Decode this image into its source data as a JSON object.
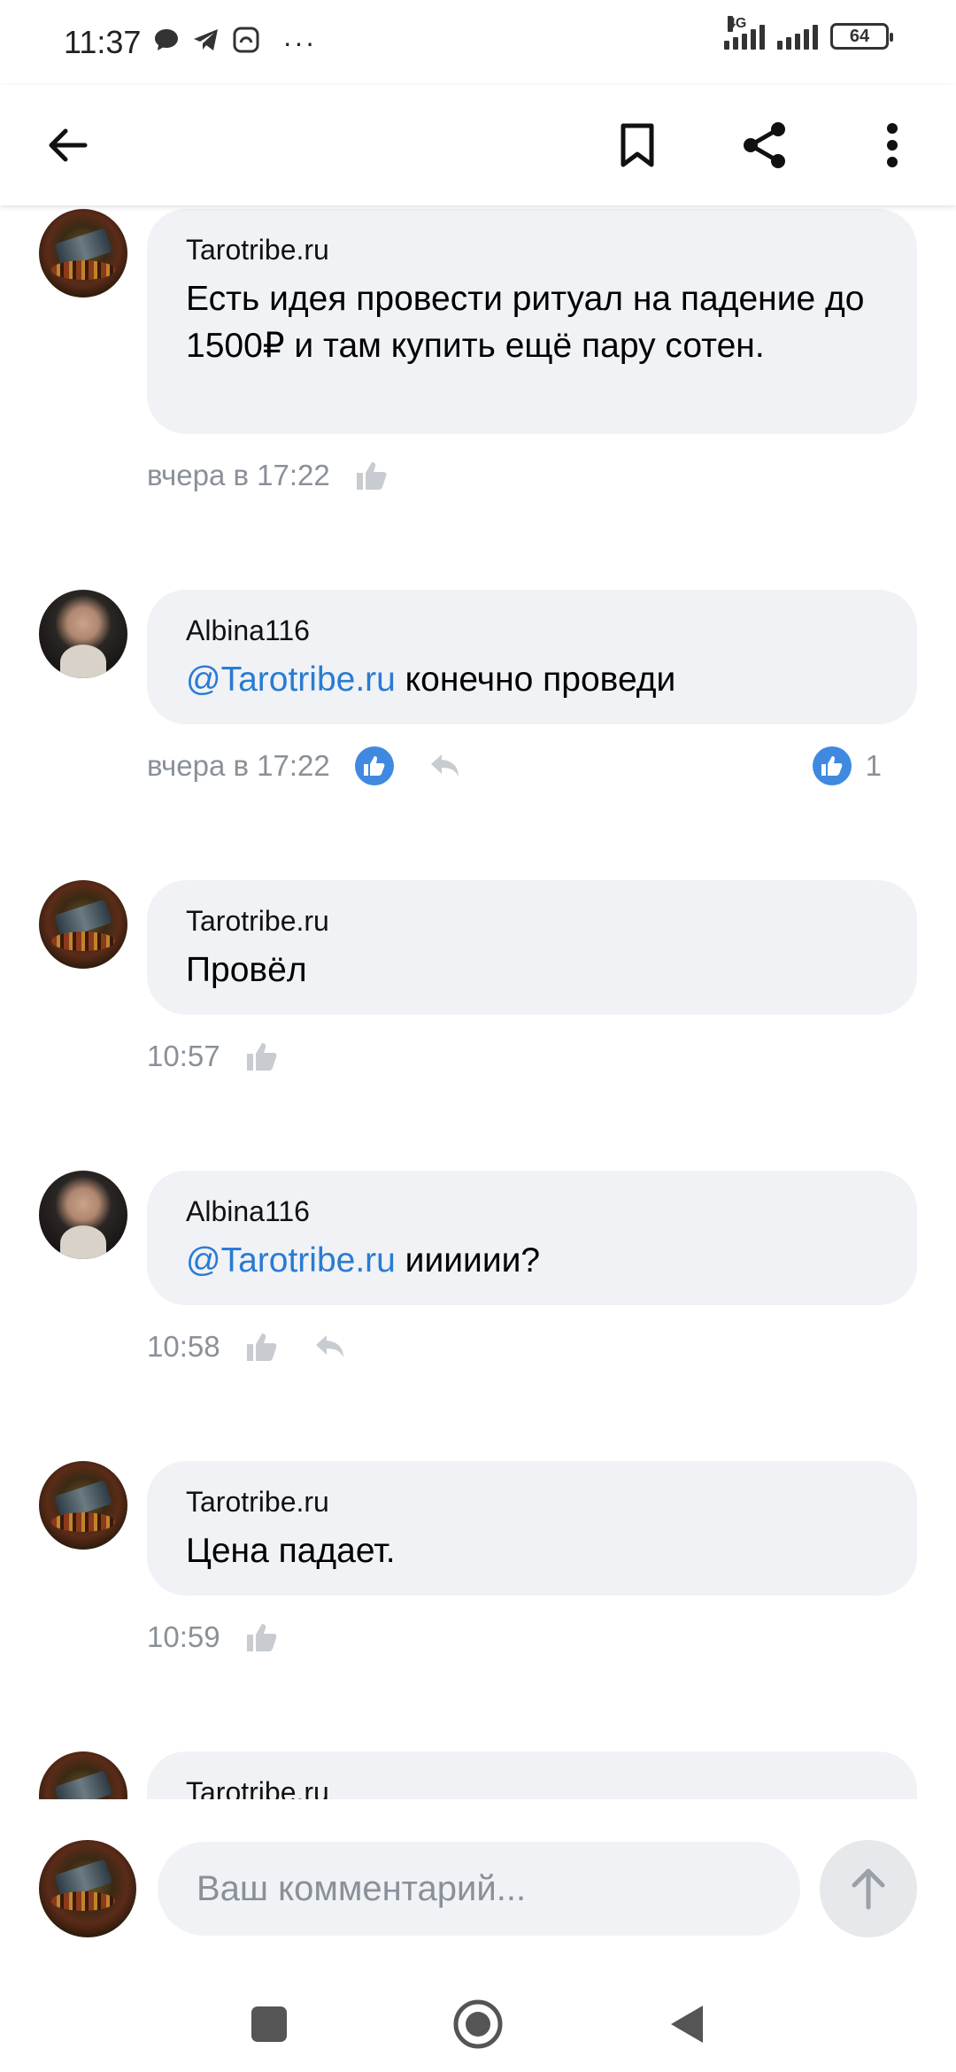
{
  "status_bar": {
    "time": "11:37",
    "network": "4G",
    "battery": "64",
    "more": "···"
  },
  "top_bar": {
    "icons": [
      "back-arrow-icon",
      "bookmark-icon",
      "share-icon",
      "more-vert-icon"
    ]
  },
  "comments": [
    {
      "author": "Tarotribe.ru",
      "text": "Есть идея провести ритуал на падение до 1500₽ и там купить ещё пару сотен.",
      "mention": "",
      "time": "вчера в 17:22",
      "liked": false,
      "reply": false,
      "likes": ""
    },
    {
      "author": "Albina116",
      "mention": "@Tarotribe.ru",
      "text": " конечно проведи",
      "time": "вчера в 17:22",
      "liked": true,
      "reply": true,
      "likes": "1"
    },
    {
      "author": "Tarotribe.ru",
      "text": "Провёл",
      "mention": "",
      "time": "10:57",
      "liked": false,
      "reply": false,
      "likes": ""
    },
    {
      "author": "Albina116",
      "mention": "@Tarotribe.ru",
      "text": " ииииии?",
      "time": "10:58",
      "liked": false,
      "reply": true,
      "likes": ""
    },
    {
      "author": "Tarotribe.ru",
      "text": "Цена падает.",
      "mention": "",
      "time": "10:59",
      "liked": false,
      "reply": false,
      "likes": ""
    },
    {
      "author": "Tarotribe.ru",
      "text": "",
      "mention": "",
      "time": "",
      "liked": false,
      "reply": false,
      "likes": ""
    }
  ],
  "composer": {
    "placeholder": "Ваш комментарий..."
  },
  "colors": {
    "accent": "#2a7bd3",
    "like_active": "#3f8ae0",
    "bubble_bg": "#f0f2f5",
    "meta_text": "#8a9099"
  }
}
